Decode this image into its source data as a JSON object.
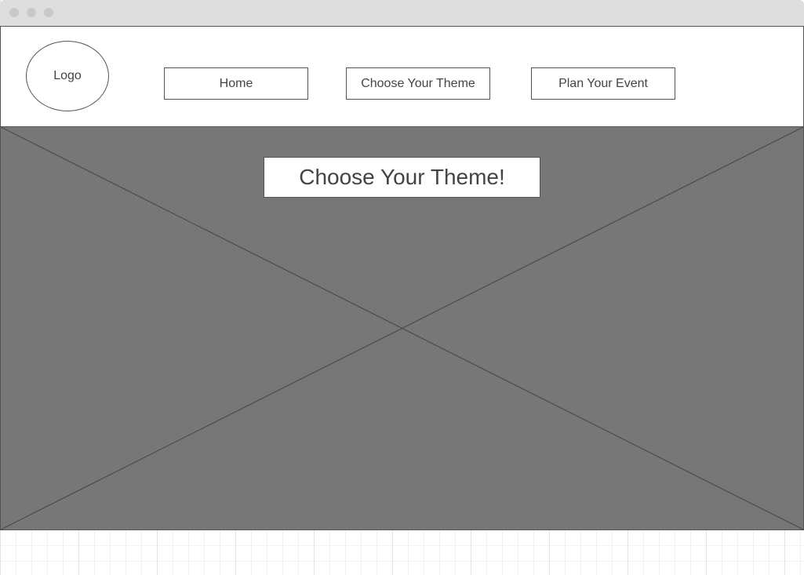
{
  "header": {
    "logo_label": "Logo",
    "nav": {
      "home": "Home",
      "choose_theme": "Choose Your Theme",
      "plan_event": "Plan Your Event"
    }
  },
  "hero": {
    "title": "Choose Your Theme!",
    "background_color": "#777777"
  },
  "colors": {
    "stroke": "#555555",
    "text": "#444444",
    "titlebar": "#dddddd"
  }
}
